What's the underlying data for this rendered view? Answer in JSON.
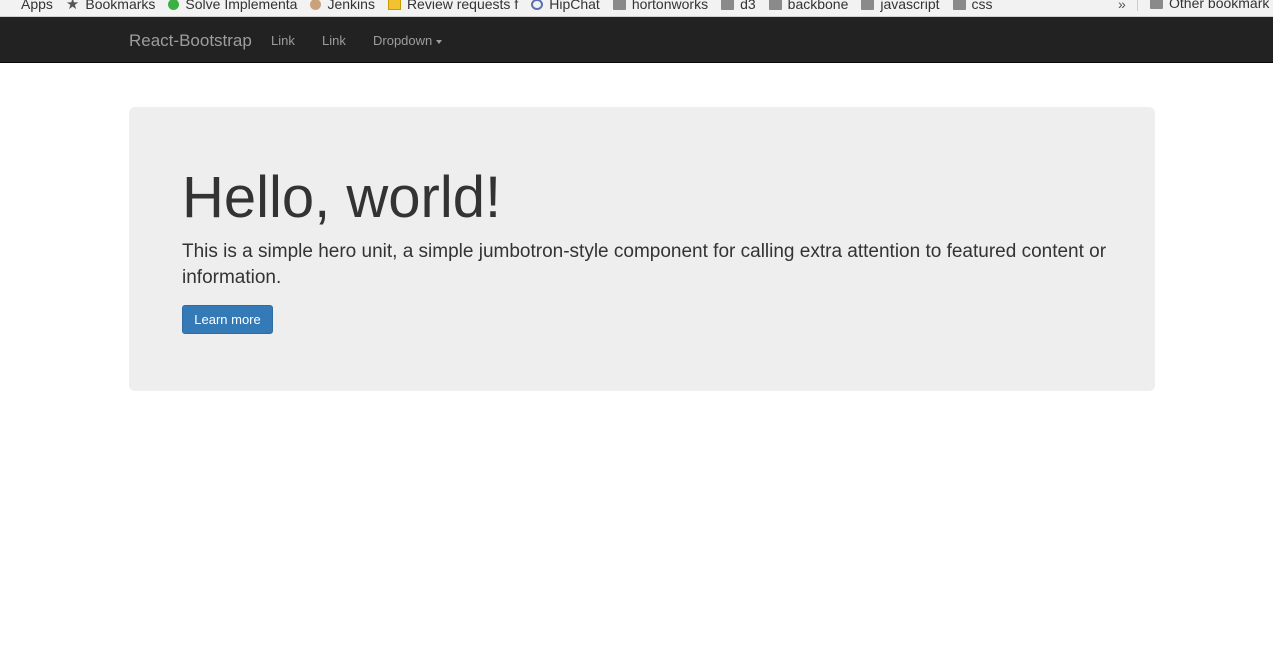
{
  "bookmarks_bar": {
    "items": [
      {
        "label": "Apps",
        "icon": "apps-grid-icon"
      },
      {
        "label": "Bookmarks",
        "icon": "star-icon"
      },
      {
        "label": "Solve Implementa",
        "icon": "green-site-icon"
      },
      {
        "label": "Jenkins",
        "icon": "jenkins-icon"
      },
      {
        "label": "Review requests f",
        "icon": "review-board-icon"
      },
      {
        "label": "HipChat",
        "icon": "hipchat-icon"
      },
      {
        "label": "hortonworks",
        "icon": "folder-icon"
      },
      {
        "label": "d3",
        "icon": "folder-icon"
      },
      {
        "label": "backbone",
        "icon": "folder-icon"
      },
      {
        "label": "javascript",
        "icon": "folder-icon"
      },
      {
        "label": "css",
        "icon": "folder-icon"
      }
    ],
    "overflow_chevron": "»",
    "other_bookmarks": "Other bookmark"
  },
  "navbar": {
    "brand": "React-Bootstrap",
    "links": [
      "Link",
      "Link"
    ],
    "dropdown_label": "Dropdown",
    "background_color": "#222222",
    "text_color": "#9d9d9d"
  },
  "jumbotron": {
    "heading": "Hello, world!",
    "text": "This is a simple hero unit, a simple jumbotron-style component for calling extra attention to featured content or information.",
    "button_label": "Learn more",
    "button_color": "#337ab7",
    "background_color": "#eeeeee"
  }
}
